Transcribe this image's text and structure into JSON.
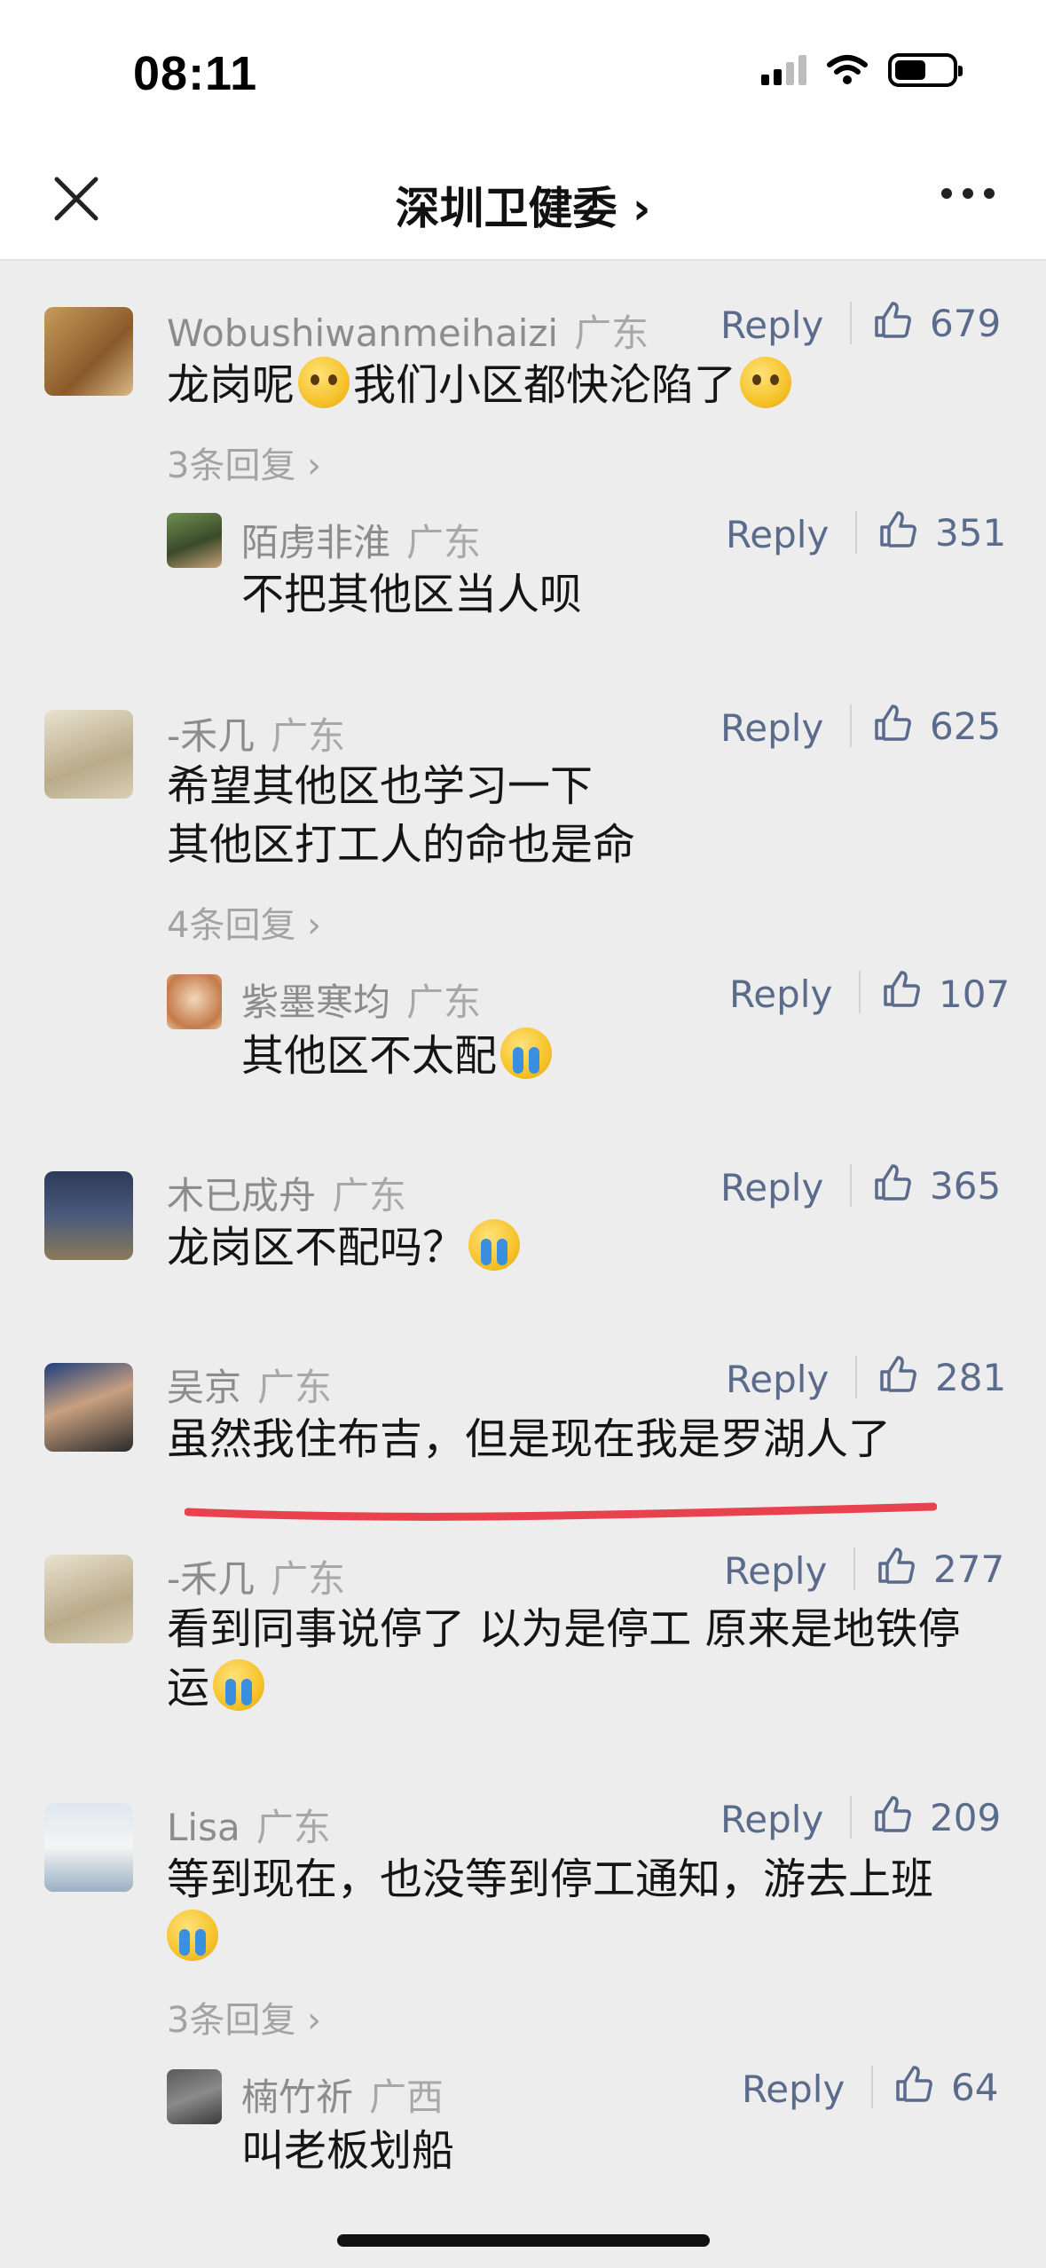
{
  "status_bar": {
    "time": "08:11"
  },
  "nav": {
    "title": "深圳卫健委 ›"
  },
  "comments": [
    {
      "name": "Wobushiwanmeihaizi",
      "region": "广东",
      "reply": "Reply",
      "likes": "679",
      "text": "龙岗呢",
      "text2": "我们小区都快沦陷了",
      "more": "3条回复 ›",
      "sub": {
        "name": "陌虏非淮",
        "region": "广东",
        "reply": "Reply",
        "likes": "351",
        "text": "不把其他区当人呗"
      }
    },
    {
      "name": "-禾几",
      "region": "广东",
      "reply": "Reply",
      "likes": "625",
      "text": "希望其他区也学习一下",
      "text2": "其他区打工人的命也是命",
      "more": "4条回复 ›",
      "sub": {
        "name": "紫墨寒均",
        "region": "广东",
        "reply": "Reply",
        "likes": "107",
        "text": "其他区不太配"
      }
    },
    {
      "name": "木已成舟",
      "region": "广东",
      "reply": "Reply",
      "likes": "365",
      "text": "龙岗区不配吗？"
    },
    {
      "name": "吴京",
      "region": "广东",
      "reply": "Reply",
      "likes": "281",
      "text": "虽然我住布吉，但是现在我是罗湖人了"
    },
    {
      "name": "-禾几",
      "region": "广东",
      "reply": "Reply",
      "likes": "277",
      "text": "看到同事说停了 以为是停工 原来是地铁停",
      "text2": "运"
    },
    {
      "name": "Lisa",
      "region": "广东",
      "reply": "Reply",
      "likes": "209",
      "text": "等到现在，也没等到停工通知，游去上班",
      "more": "3条回复 ›",
      "sub": {
        "name": "楠竹祈",
        "region": "广西",
        "reply": "Reply",
        "likes": "64",
        "text": "叫老板划船"
      }
    }
  ],
  "colors": {
    "accent": "#5b6b8c",
    "underline": "#e8424e",
    "background": "#ededed"
  }
}
